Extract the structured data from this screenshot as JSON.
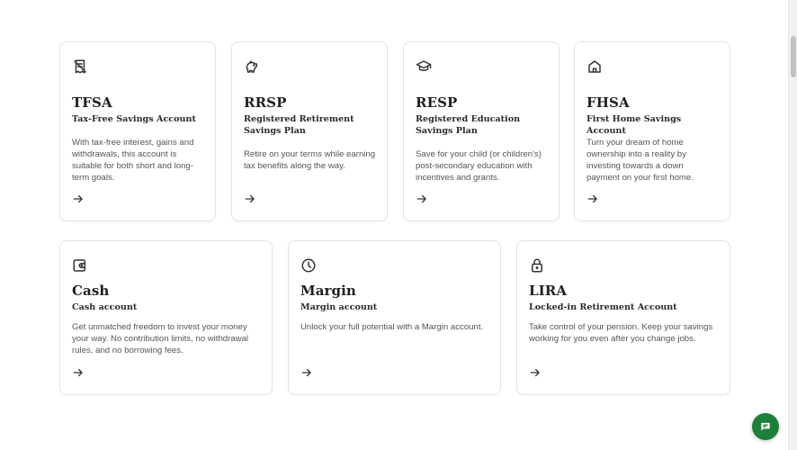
{
  "accounts_top": [
    {
      "id": "tfsa",
      "icon": "no-tax-receipt-icon",
      "title": "TFSA",
      "subtitle": "Tax-Free Savings Account",
      "description": "With tax-free interest, gains and withdrawals, this account is suitable for both short and long-term goals."
    },
    {
      "id": "rrsp",
      "icon": "piggy-bank-icon",
      "title": "RRSP",
      "subtitle": "Registered Retirement Savings Plan",
      "description": "Retire on your terms while earning tax benefits along the way."
    },
    {
      "id": "resp",
      "icon": "graduation-cap-icon",
      "title": "RESP",
      "subtitle": "Registered Education Savings Plan",
      "description": "Save for your child (or children's) post-secondary education with incentives and grants."
    },
    {
      "id": "fhsa",
      "icon": "home-icon",
      "title": "FHSA",
      "subtitle": "First Home Savings Account",
      "description": "Turn your dream of home ownership into a reality by investing towards a down payment on your first home."
    }
  ],
  "accounts_bottom": [
    {
      "id": "cash",
      "icon": "wallet-icon",
      "title": "Cash",
      "subtitle": "Cash account",
      "description": "Get unmatched freedom to invest your money your way. No contribution limits, no withdrawal rules, and no borrowing fees."
    },
    {
      "id": "margin",
      "icon": "clock-icon",
      "title": "Margin",
      "subtitle": "Margin account",
      "description": "Unlock your full potential with a Margin account."
    },
    {
      "id": "lira",
      "icon": "lock-icon",
      "title": "LIRA",
      "subtitle": "Locked-in Retirement Account",
      "description": "Take control of your pension. Keep your savings working for you even after you change jobs."
    }
  ],
  "chat": {
    "icon": "chat-bubble-icon",
    "color": "#1d7f3a"
  }
}
